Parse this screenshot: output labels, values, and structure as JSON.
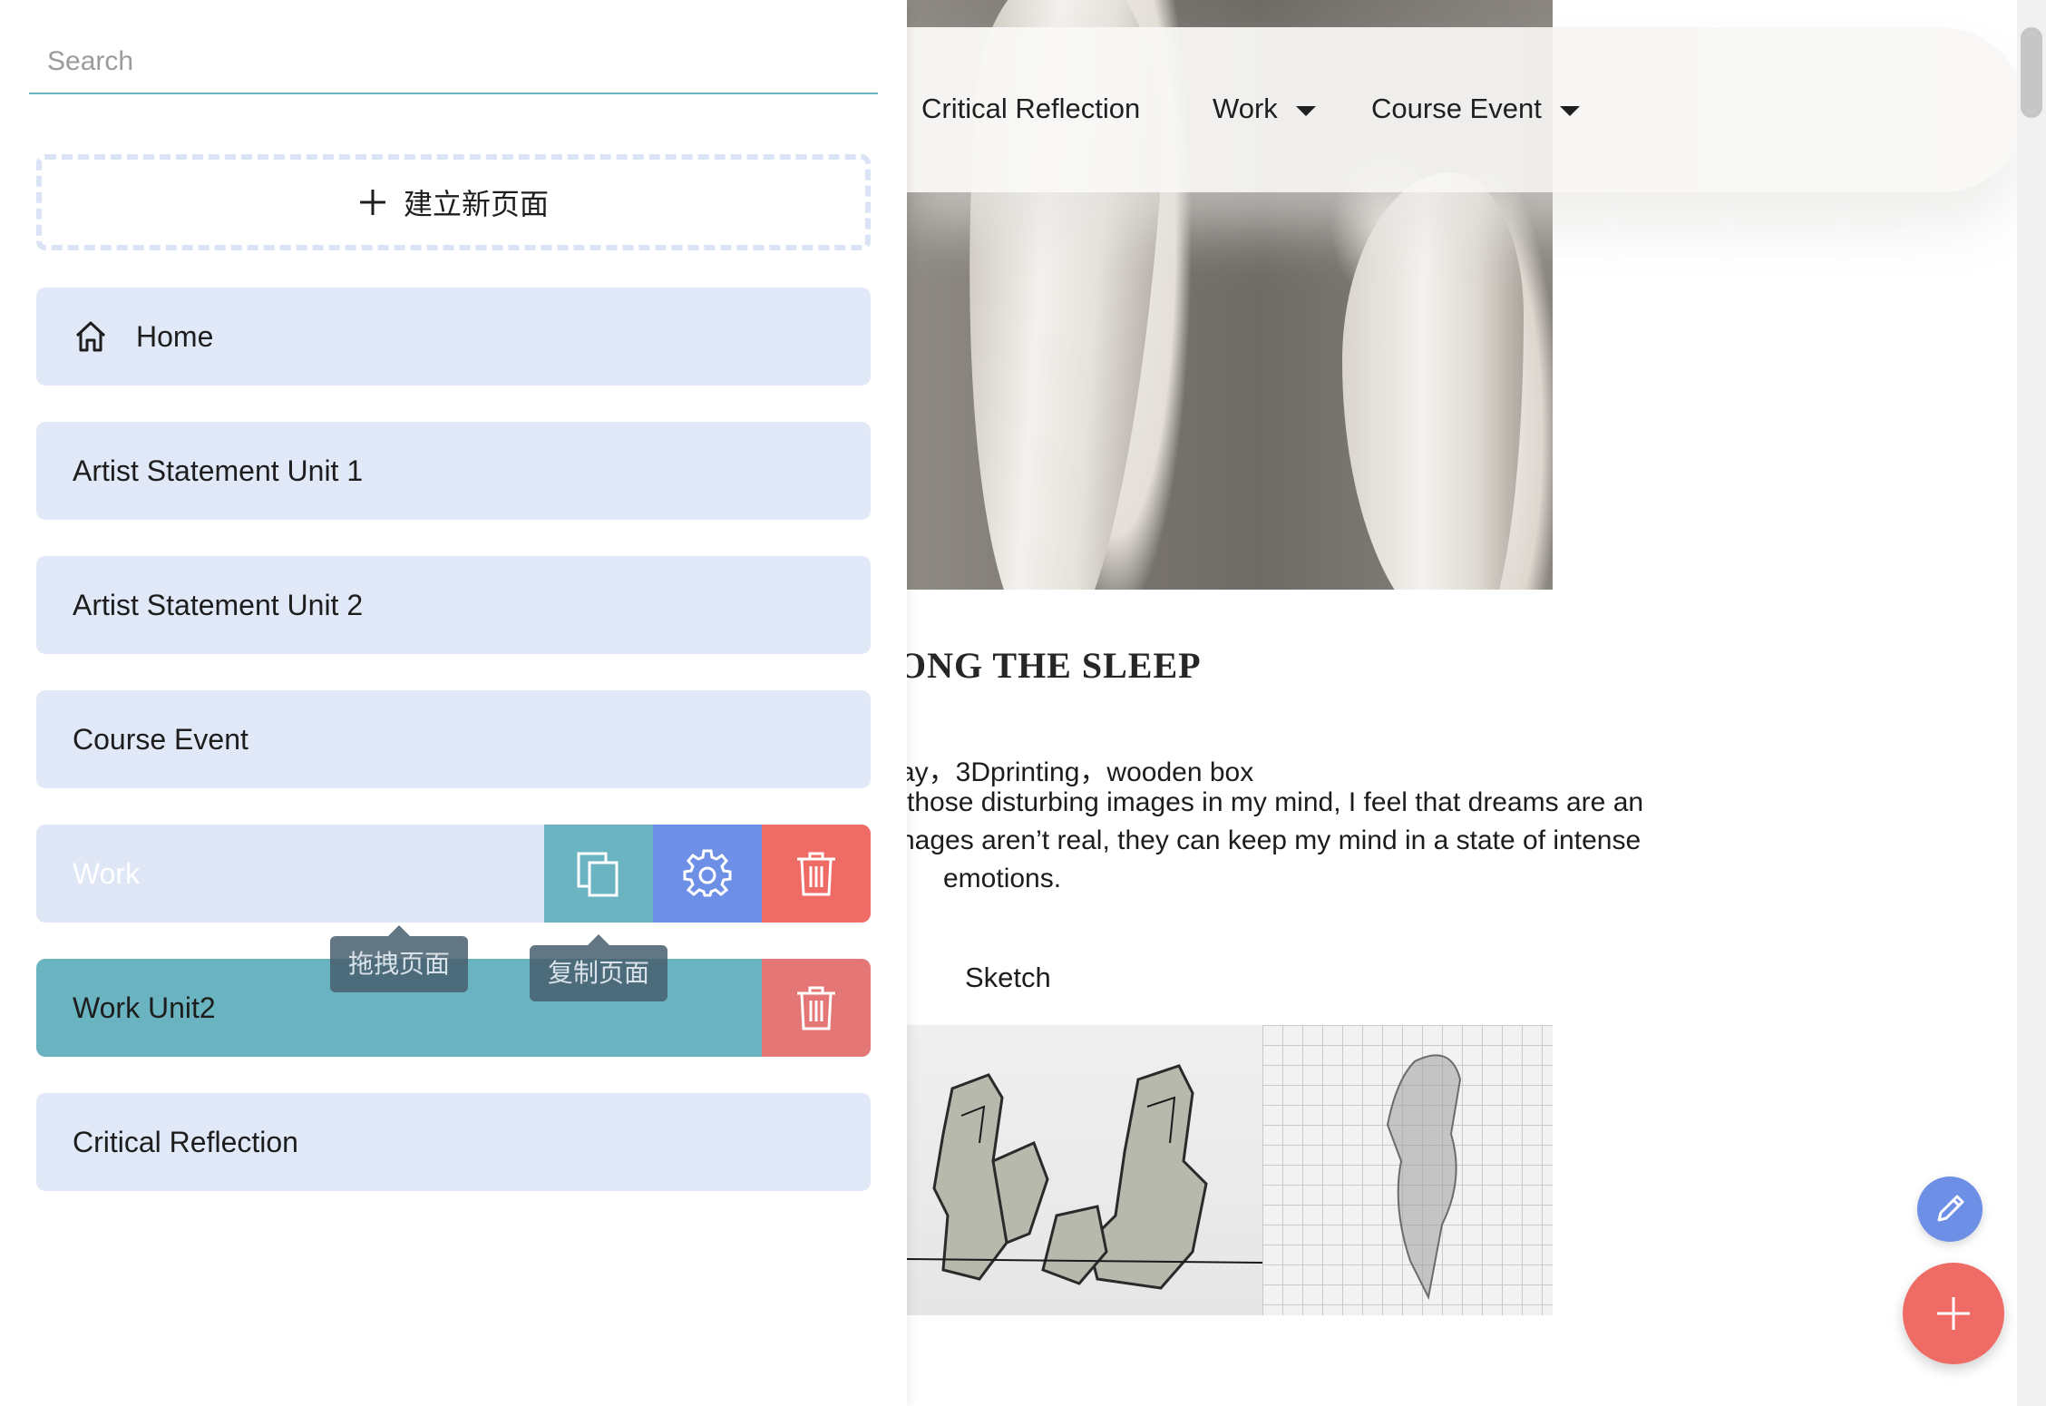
{
  "panel": {
    "search": {
      "placeholder": "Search",
      "value": ""
    },
    "new_page_label": "建立新页面",
    "pages": [
      {
        "label": "Home",
        "icon": "home-icon"
      },
      {
        "label": "Artist Statement Unit 1"
      },
      {
        "label": "Artist Statement Unit 2"
      },
      {
        "label": "Course Event"
      },
      {
        "label": "Work",
        "state": "hovered"
      },
      {
        "label": "Work Unit2",
        "state": "active"
      },
      {
        "label": "Critical Reflection"
      }
    ],
    "tooltips": {
      "drag": "拖拽页面",
      "copy": "复制页面"
    },
    "action_icons": {
      "copy": "copy-icon",
      "settings": "gear-icon",
      "delete": "trash-icon"
    }
  },
  "site": {
    "nav": [
      {
        "label": "Critical Reflection"
      },
      {
        "label": "Work",
        "has_dropdown": true
      },
      {
        "label": "Course Event",
        "has_dropdown": true
      }
    ],
    "work_title": "ONG THE SLEEP",
    "materials_line": "ay，3Dprinting，wooden box",
    "description_lines": [
      "those disturbing images in my mind, I feel that dreams are an",
      "nages aren’t real, they can keep my mind in a state of intense",
      "emotions."
    ],
    "sketch_label": "Sketch",
    "fab_icons": {
      "edit": "pen-icon",
      "add": "plus-icon"
    }
  },
  "colors": {
    "accent_teal": "#6ab4c1",
    "accent_blue": "#6e8fe6",
    "danger_red": "#ef6b66",
    "page_item_bg": "#e1e8f7"
  }
}
